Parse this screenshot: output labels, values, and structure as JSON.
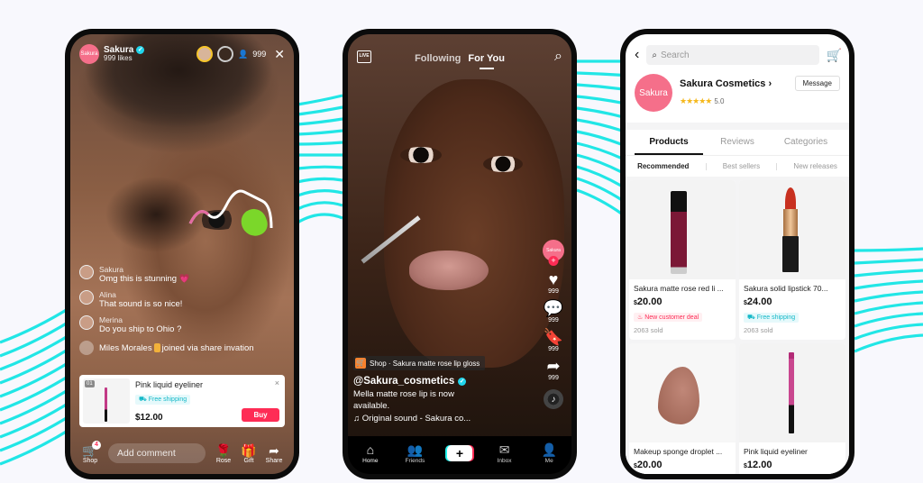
{
  "colors": {
    "background": "#f8f8fd",
    "wave": "#21e6e6",
    "brand_pink": "#f56f8a",
    "tiktok_red": "#fe2c55",
    "tiktok_cyan": "#25f4ee",
    "star": "#f5b81c"
  },
  "live": {
    "host_avatar_text": "Sakura",
    "host_name": "Sakura",
    "likes": "999 likes",
    "viewer_count": "999",
    "icons": [
      "verified-icon",
      "viewer-avatar",
      "person-icon",
      "close-icon"
    ],
    "comments": [
      {
        "user": "Sakura",
        "text": "Omg this is stunning 💗"
      },
      {
        "user": "Alina",
        "text": "That sound is so nice!"
      },
      {
        "user": "Merina",
        "text": "Do you ship to Ohio ?"
      }
    ],
    "join_notice": {
      "user": "Miles Morales",
      "text": "joined via share invation"
    },
    "pinned_product": {
      "index": "01",
      "title": "Pink liquid eyeliner",
      "shipping_tag": "Free shipping",
      "price": "$12.00",
      "buy_label": "Buy",
      "close": "×"
    },
    "bottom_bar": {
      "shop_label": "Shop",
      "shop_badge": "4",
      "comment_placeholder": "Add comment",
      "rose_label": "Rose",
      "gift_label": "Gift",
      "share_label": "Share"
    }
  },
  "feed": {
    "live_icon_text": "LIVE",
    "tabs": [
      {
        "label": "Following",
        "active": false
      },
      {
        "label": "For You",
        "active": true
      }
    ],
    "creator_avatar_text": "Sakura",
    "actions": [
      {
        "icon": "heart-icon",
        "count": "999"
      },
      {
        "icon": "comment-icon",
        "count": "999"
      },
      {
        "icon": "bookmark-icon",
        "count": "999"
      },
      {
        "icon": "share-icon",
        "count": "999"
      }
    ],
    "shop_strip": "Shop · Sakura matte rose lip gloss",
    "handle": "@Sakura_cosmetics",
    "description": "Mella matte rose lip is now available.",
    "sound": "Original sound - Sakura co...",
    "nav": [
      {
        "label": "Home",
        "icon": "home-icon",
        "active": true
      },
      {
        "label": "Friends",
        "icon": "friends-icon",
        "active": false
      },
      {
        "label": "+",
        "icon": "create-icon",
        "active": false
      },
      {
        "label": "Inbox",
        "icon": "inbox-icon",
        "active": false
      },
      {
        "label": "Me",
        "icon": "profile-icon",
        "active": false
      }
    ]
  },
  "shop": {
    "search_placeholder": "Search",
    "store_logo_text": "Sakura",
    "store_name": "Sakura Cosmetics",
    "store_chevron": "›",
    "stars": "★★★★★",
    "rating": "5.0",
    "message_label": "Message",
    "tabs": [
      {
        "label": "Products",
        "active": true
      },
      {
        "label": "Reviews",
        "active": false
      },
      {
        "label": "Categories",
        "active": false
      }
    ],
    "subtabs": [
      {
        "label": "Recommended",
        "active": true
      },
      {
        "label": "Best sellers",
        "active": false
      },
      {
        "label": "New releases",
        "active": false
      }
    ],
    "products": [
      {
        "title": "Sakura matte rose red li ...",
        "currency": "$",
        "price": "20.00",
        "tag": "New customer deal",
        "tag_type": "deal",
        "sold": "2063 sold"
      },
      {
        "title": "Sakura solid lipstick 70...",
        "currency": "$",
        "price": "24.00",
        "tag": "Free shipping",
        "tag_type": "shipping",
        "sold": "2063 sold"
      },
      {
        "title": "Makeup sponge droplet ...",
        "currency": "$",
        "price": "20.00"
      },
      {
        "title": "Pink liquid eyeliner",
        "currency": "$",
        "price": "12.00"
      }
    ]
  }
}
